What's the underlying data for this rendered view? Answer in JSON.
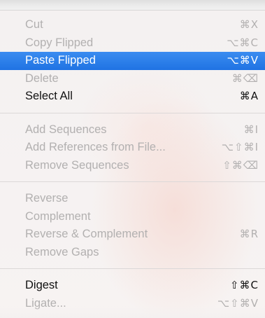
{
  "menu": {
    "groups": [
      {
        "items": [
          {
            "label": "Cut",
            "shortcut": "⌘X",
            "enabled": false
          },
          {
            "label": "Copy Flipped",
            "shortcut": "⌥⌘C",
            "enabled": false
          },
          {
            "label": "Paste Flipped",
            "shortcut": "⌥⌘V",
            "enabled": true,
            "highlighted": true
          },
          {
            "label": "Delete",
            "shortcut": "⌘⌫",
            "enabled": false
          },
          {
            "label": "Select All",
            "shortcut": "⌘A",
            "enabled": true
          }
        ]
      },
      {
        "items": [
          {
            "label": "Add Sequences",
            "shortcut": "⌘I",
            "enabled": false
          },
          {
            "label": "Add References from File...",
            "shortcut": "⌥⇧⌘I",
            "enabled": false
          },
          {
            "label": "Remove Sequences",
            "shortcut": "⇧⌘⌫",
            "enabled": false
          }
        ]
      },
      {
        "items": [
          {
            "label": "Reverse",
            "shortcut": "",
            "enabled": false
          },
          {
            "label": "Complement",
            "shortcut": "",
            "enabled": false
          },
          {
            "label": "Reverse & Complement",
            "shortcut": "⌘R",
            "enabled": false
          },
          {
            "label": "Remove Gaps",
            "shortcut": "",
            "enabled": false
          }
        ]
      },
      {
        "items": [
          {
            "label": "Digest",
            "shortcut": "⇧⌘C",
            "enabled": true
          },
          {
            "label": "Ligate...",
            "shortcut": "⌥⇧⌘V",
            "enabled": false
          }
        ]
      }
    ]
  },
  "colors": {
    "highlight": "#2d7fe8",
    "enabled_text": "#111111",
    "disabled_text": "#b2b0b0"
  }
}
